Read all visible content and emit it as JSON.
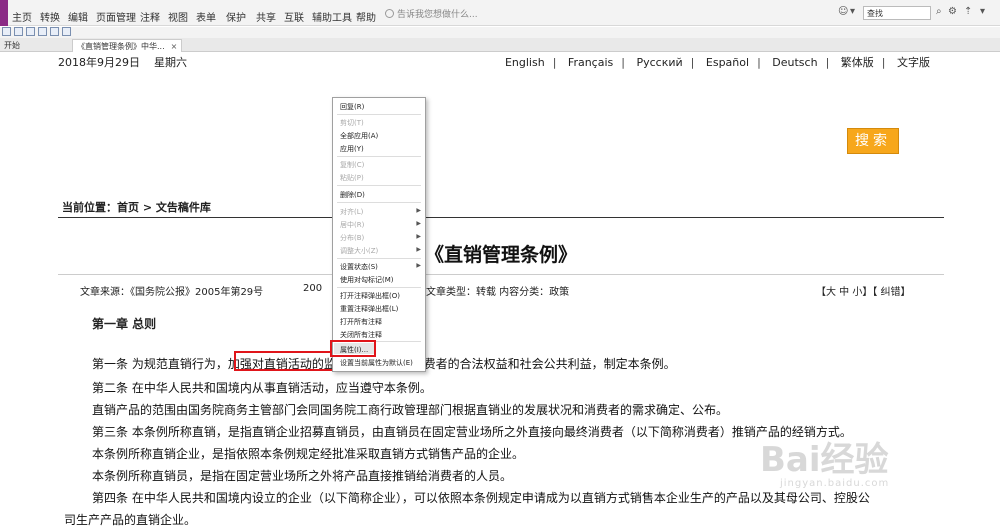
{
  "menubar": {
    "items": [
      "主页",
      "转换",
      "编辑",
      "页面管理",
      "注释",
      "视图",
      "表单",
      "保护",
      "共享",
      "互联",
      "辅助工具",
      "帮助"
    ],
    "help_placeholder": "告诉我您想做什么...",
    "search_placeholder": "查找"
  },
  "tabs": [
    {
      "label": "开始"
    },
    {
      "label": "《直销管理条例》中华..."
    }
  ],
  "page": {
    "date": "2018年9月29日",
    "weekday": "星期六",
    "languages": [
      "English",
      "Français",
      "Русский",
      "Español",
      "Deutsch",
      "繁体版",
      "文字版"
    ],
    "search_button": "搜索",
    "breadcrumb": "当前位置：首页 >  文告稿件库",
    "title": "《直销管理条例》",
    "meta_source": "文章来源：《国务院公报》2005年第29号",
    "meta_year": "200",
    "meta_type": "文章类型：转载   内容分类：政策",
    "size_controls": "【大 中 小】【 纠错】",
    "chapter": "第一章 总则",
    "paragraphs": [
      "第一条 为规范直销行为，加强对直销活动的监    督管理，保护消费者的合法权益和社会公共利益，制定本条例。",
      "第二条 在中华人民共和国境内从事直销活动，应当遵守本条例。",
      "直销产品的范围由国务院商务主管部门会同国务院工商行政管理部门根据直销业的发展状况和消费者的需求确定、公布。",
      "第三条 本条例所称直销，是指直销企业招募直销员，由直销员在固定营业场所之外直接向最终消费者（以下简称消费者）推销产品的经销方式。",
      "本条例所称直销企业，是指依照本条例规定经批准采取直销方式销售产品的企业。",
      "本条例所称直销员，是指在固定营业场所之外将产品直接推销给消费者的人员。",
      "第四条 在中华人民共和国境内设立的企业（以下简称企业），可以依照本条例规定申请成为以直销方式销售本企业生产的产品以及其母公司、控股公",
      "司生产产品的直销企业。"
    ]
  },
  "context_menu": {
    "items": [
      {
        "label": "回复(R)",
        "disabled": false
      },
      {
        "label": "剪切(T)",
        "disabled": true
      },
      {
        "label": "全部应用(A)",
        "disabled": false
      },
      {
        "label": "应用(Y)",
        "disabled": false
      },
      {
        "label": "复制(C)",
        "disabled": true
      },
      {
        "label": "粘贴(P)",
        "disabled": true
      },
      {
        "label": "删除(D)",
        "disabled": false
      },
      {
        "label": "对齐(L)",
        "disabled": true
      },
      {
        "label": "居中(R)",
        "disabled": true
      },
      {
        "label": "分布(B)",
        "disabled": true
      },
      {
        "label": "调整大小(Z)",
        "disabled": true
      },
      {
        "label": "设置状态(S)",
        "disabled": false
      },
      {
        "label": "使用对勾标记(M)",
        "disabled": false
      },
      {
        "label": "打开注释弹出框(O)",
        "disabled": false
      },
      {
        "label": "重置注释弹出框(L)",
        "disabled": false
      },
      {
        "label": "打开所有注释",
        "disabled": false
      },
      {
        "label": "关闭所有注释",
        "disabled": false
      },
      {
        "label": "属性(I)...",
        "disabled": false
      },
      {
        "label": "设置当前属性为默认(E)",
        "disabled": false
      }
    ]
  },
  "watermark": {
    "brand": "Bai经验",
    "sub": "jingyan.baidu.com"
  }
}
